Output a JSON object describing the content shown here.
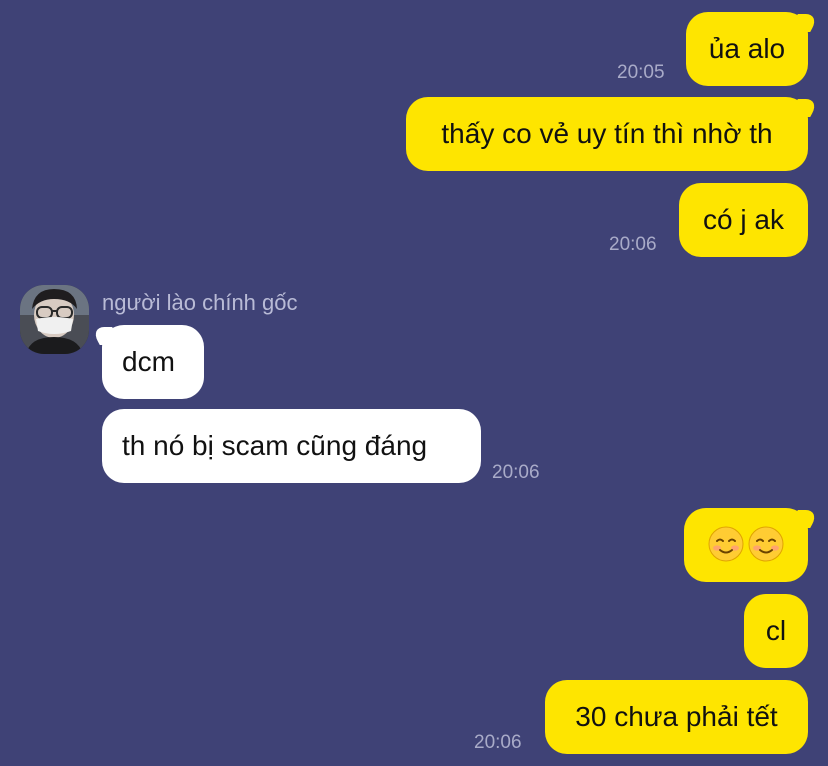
{
  "chat": {
    "outgoing_color": "#fee500",
    "incoming_color": "#ffffff",
    "background_color": "#3f4276",
    "contact": {
      "name": "người lào chính gốc",
      "avatar": "contact-avatar-photo"
    },
    "messages": [
      {
        "direction": "out",
        "text": "ủa alo",
        "time": "20:05"
      },
      {
        "direction": "out",
        "text": "thấy co vẻ uy tín thì nhờ th",
        "time": ""
      },
      {
        "direction": "out",
        "text": "có j ak",
        "time": "20:06"
      },
      {
        "direction": "in",
        "text": "dcm",
        "time": ""
      },
      {
        "direction": "in",
        "text": "th nó bị scam cũng đáng",
        "time": "20:06"
      },
      {
        "direction": "out",
        "text": "",
        "emoji": [
          "smiling-face-icon",
          "smiling-face-icon"
        ],
        "time": ""
      },
      {
        "direction": "out",
        "text": "cl",
        "time": ""
      },
      {
        "direction": "out",
        "text": "30 chưa phải tết",
        "time": "20:06"
      }
    ]
  }
}
